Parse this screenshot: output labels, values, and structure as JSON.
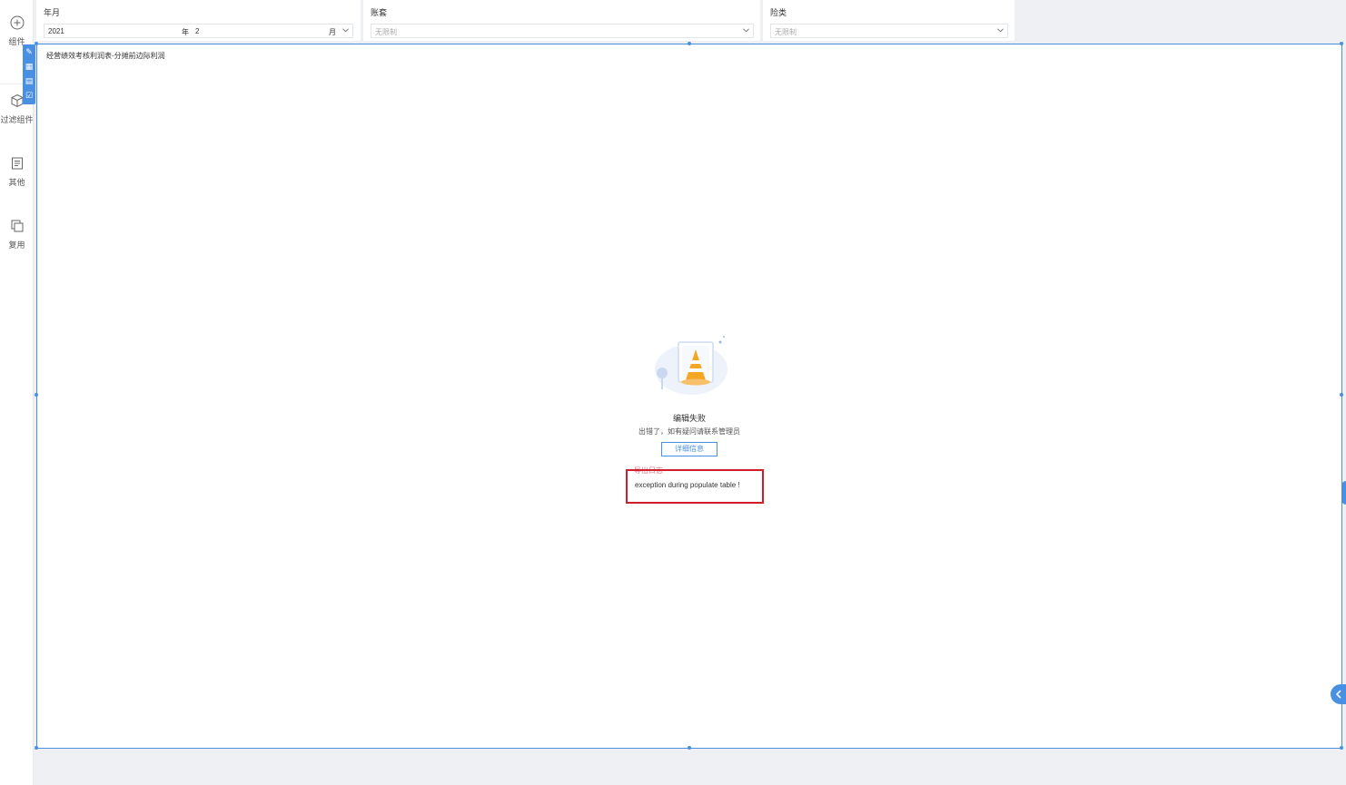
{
  "sidebar": {
    "items": [
      {
        "label": "组件",
        "icon": "plus-circle-icon"
      },
      {
        "label": "过滤组件",
        "icon": "cube-icon"
      },
      {
        "label": "其他",
        "icon": "document-icon"
      },
      {
        "label": "复用",
        "icon": "copy-icon"
      }
    ]
  },
  "toolstrip": {
    "items": [
      {
        "icon": "edit-icon",
        "glyph": "✎"
      },
      {
        "icon": "chart-icon",
        "glyph": "▦"
      },
      {
        "icon": "comment-icon",
        "glyph": "▤"
      },
      {
        "icon": "check-square-icon",
        "glyph": "☑"
      }
    ]
  },
  "filters": {
    "yearmonth": {
      "label": "年月",
      "year_value": "2021",
      "year_unit": "年",
      "month_value": "2",
      "month_unit": "月"
    },
    "ledger": {
      "label": "账套",
      "placeholder": "无限制"
    },
    "insurance": {
      "label": "险类",
      "placeholder": "无限制"
    }
  },
  "panel": {
    "title": "经营绩效考核利润表-分摊前边际利润",
    "error_title": "编辑失败",
    "error_subtitle": "出错了，如有疑问请联系管理员",
    "detail_button": "详细信息",
    "log_label": "导出日志",
    "log_message": "exception during populate table !"
  },
  "colors": {
    "accent": "#4a90e2",
    "highlight_box": "#d01f2a",
    "cone_orange": "#f5a623"
  }
}
